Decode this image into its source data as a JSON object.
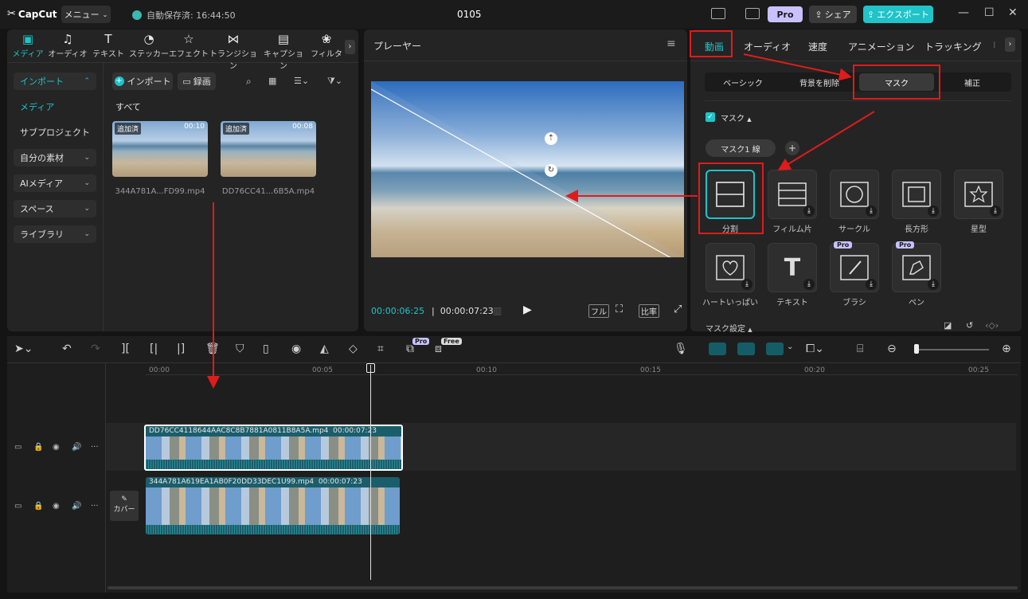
{
  "app": {
    "logo": "CapCut",
    "menu": "メニュー",
    "autosave": "自動保存済: 16:44:50",
    "title": "0105",
    "pro": "Pro",
    "share": "シェア",
    "export": "エクスポート"
  },
  "media": {
    "tabs": [
      "メディア",
      "オーディオ",
      "テキスト",
      "ステッカー",
      "エフェクト",
      "トランジション",
      "キャプション",
      "フィルタ"
    ],
    "sidebar": [
      "インポート",
      "メディア",
      "サブプロジェクト",
      "自分の素材",
      "AIメディア",
      "スペース",
      "ライブラリ"
    ],
    "import_button": "インポート",
    "record_button": "録画",
    "all_label": "すべて",
    "files": [
      {
        "tag": "追加済",
        "duration": "00:10",
        "name": "344A781A...FD99.mp4"
      },
      {
        "tag": "追加済",
        "duration": "00:08",
        "name": "DD76CC41...6B5A.mp4"
      }
    ]
  },
  "player": {
    "title": "プレーヤー",
    "current_time": "00:00:06:25",
    "total_time": "00:00:07:23",
    "full": "フル",
    "ratio": "比率"
  },
  "right": {
    "tabs": [
      "動画",
      "オーディオ",
      "速度",
      "アニメーション",
      "トラッキング"
    ],
    "subtabs": [
      "ベーシック",
      "背景を削除",
      "マスク",
      "補正"
    ],
    "mask_section": "マスク",
    "mask_chip": "マスク1 線",
    "masks": [
      {
        "label": "分割"
      },
      {
        "label": "フィルム片"
      },
      {
        "label": "サークル"
      },
      {
        "label": "長方形"
      },
      {
        "label": "星型"
      },
      {
        "label": "ハートいっぱい"
      },
      {
        "label": "テキスト"
      },
      {
        "label": "ブラシ"
      },
      {
        "label": "ペン"
      }
    ],
    "mask_settings": "マスク設定"
  },
  "timeline": {
    "ruler": [
      "00:00",
      "00:05",
      "00:10",
      "00:15",
      "00:20",
      "00:25"
    ],
    "pro_badge": "Pro",
    "free_badge": "Free",
    "clip1_name": "DD76CC4118644AAC8C8B7881A0811B8A5A.mp4",
    "clip1_duration": "00:00:07:23",
    "clip2_name": "344A781A619EA1AB0F20DD33DEC1U99.mp4",
    "clip2_duration": "00:00:07:23",
    "cover": "カバー"
  }
}
